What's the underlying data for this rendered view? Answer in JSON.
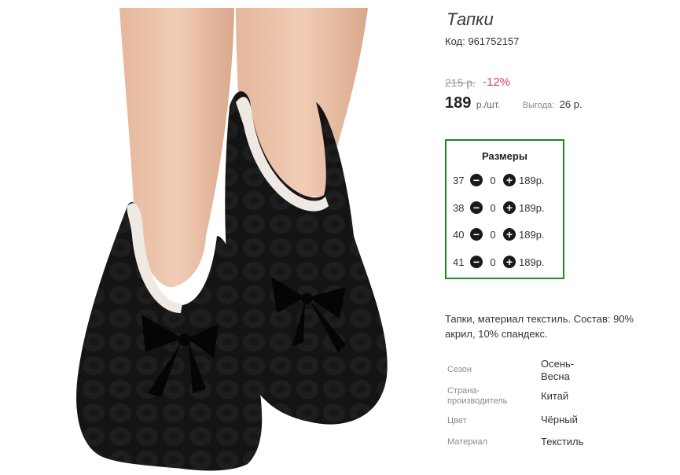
{
  "product": {
    "title": "Тапки",
    "code_label": "Код:",
    "code_value": "961752157",
    "old_price": "215 р.",
    "discount": "-12%",
    "price": "189",
    "price_unit": "р./шт.",
    "benefit_label": "Выгода:",
    "benefit_value": "26 р."
  },
  "sizes": {
    "title": "Размеры",
    "rows": [
      {
        "size": "37",
        "qty": "0",
        "price": "189р."
      },
      {
        "size": "38",
        "qty": "0",
        "price": "189р."
      },
      {
        "size": "40",
        "qty": "0",
        "price": "189р."
      },
      {
        "size": "41",
        "qty": "0",
        "price": "189р."
      }
    ]
  },
  "description": "Тапки, материал текстиль. Состав: 90% акрил, 10% спандекс.",
  "attributes": [
    {
      "label": "Сезон",
      "value": "Осень-Весна"
    },
    {
      "label": "Страна-производитель",
      "value": "Китай"
    },
    {
      "label": "Цвет",
      "value": "Чёрный"
    },
    {
      "label": "Материал",
      "value": "Текстиль"
    }
  ],
  "icons": {
    "minus": "minus-circle-icon",
    "plus": "plus-circle-icon"
  },
  "colors": {
    "discount": "#e0405a",
    "sizes_border": "#1e8a1e",
    "slipper": "#121212"
  }
}
